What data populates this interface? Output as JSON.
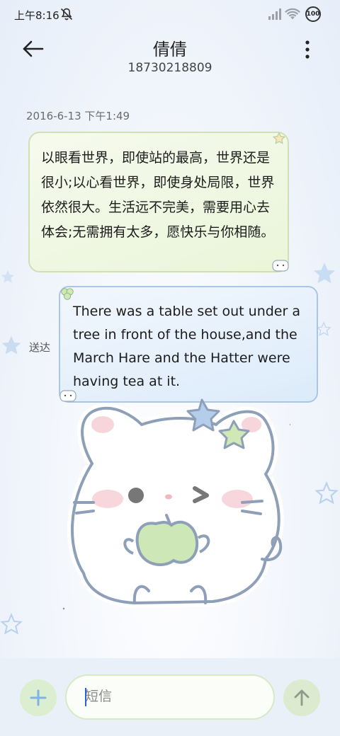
{
  "status_bar": {
    "time": "上午8:16",
    "battery": "100",
    "icons": [
      "mute-icon",
      "signal-icon",
      "wifi-icon",
      "battery-icon"
    ]
  },
  "header": {
    "contact_name": "倩倩",
    "phone_number": "18730218809",
    "back_icon": "arrow-left-icon",
    "menu_icon": "more-vertical-icon"
  },
  "conversation": {
    "timestamp": "2016-6-13 下午1:49",
    "messages": [
      {
        "direction": "incoming",
        "text": "以眼看世界，即使站的最高，世界还是很小;以心看世界，即使身处局限，世界依然很大。生活远不完美，需要用心去体会;无需拥有太多，愿快乐与你相随。"
      },
      {
        "direction": "outgoing",
        "text": "There was a table set out under a tree in front of the house,and the March Hare and the Hatter were having tea at it.",
        "status": "送达"
      }
    ]
  },
  "composer": {
    "placeholder": "短信",
    "value": "",
    "add_icon": "plus-icon",
    "send_icon": "arrow-up-icon"
  },
  "colors": {
    "incoming_bubble": "#eaf5d9",
    "outgoing_bubble": "#dcebfa",
    "accent_green": "#a7d88c",
    "accent_blue": "#a9c6e8"
  }
}
